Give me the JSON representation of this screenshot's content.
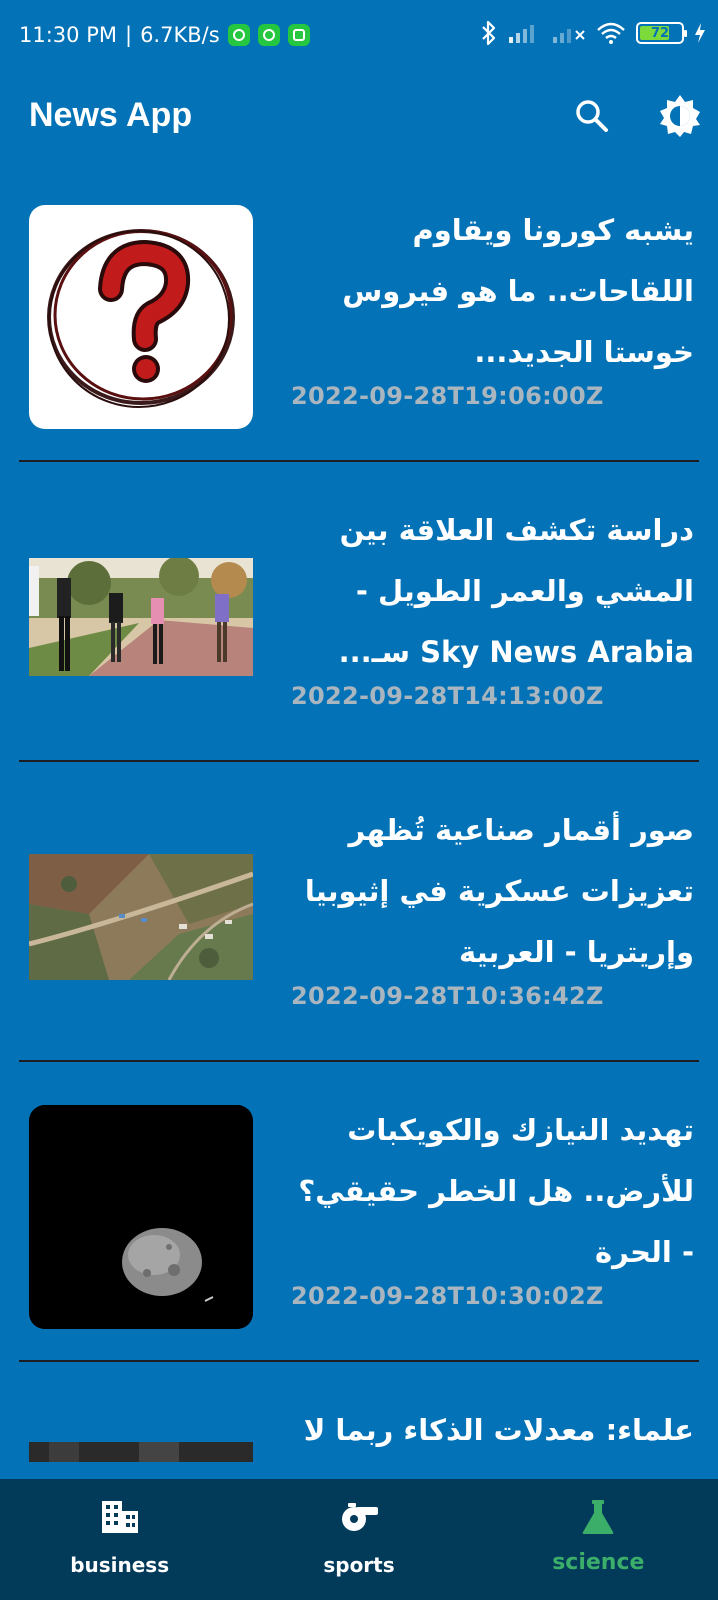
{
  "status_bar": {
    "time": "11:30 PM",
    "separator": "|",
    "speed": "6.7KB/s",
    "battery": "72",
    "battery_percent": 72
  },
  "app_bar": {
    "title": "News App"
  },
  "articles": [
    {
      "title": "يشبه كورونا ويقاوم اللقاحات.. ما هو فيروس خوستا الجديد...",
      "date": "2022-09-28T19:06:00Z",
      "thumb": "question-mark-icon"
    },
    {
      "title": "دراسة تكشف العلاقة بين المشي والعمر الطويل - Sky News Arabia سـ...",
      "date": "2022-09-28T14:13:00Z",
      "thumb": "walking-people-photo"
    },
    {
      "title": "صور أقمار صناعية تُظهر تعزيزات عسكرية في إثيوبيا وإريتريا - العربية",
      "date": "2022-09-28T10:36:42Z",
      "thumb": "satellite-photo"
    },
    {
      "title": "تهديد النيازك والكويكبات للأرض.. هل الخطر حقيقي؟ - الحرة",
      "date": "2022-09-28T10:30:02Z",
      "thumb": "asteroid-photo"
    },
    {
      "title": "علماء: معدلات الذكاء ربما لا",
      "date": "",
      "thumb": "dark-photo"
    }
  ],
  "bottom_nav": {
    "items": [
      {
        "label": "business",
        "icon": "building-icon"
      },
      {
        "label": "sports",
        "icon": "whistle-icon"
      },
      {
        "label": "science",
        "icon": "flask-icon"
      }
    ],
    "active": "science",
    "active_color": "#3BAE6A"
  },
  "colors": {
    "background": "#0372B6",
    "nav_background": "#023A5A",
    "date_text": "#A9B5BF",
    "divider": "#1B1F24"
  }
}
